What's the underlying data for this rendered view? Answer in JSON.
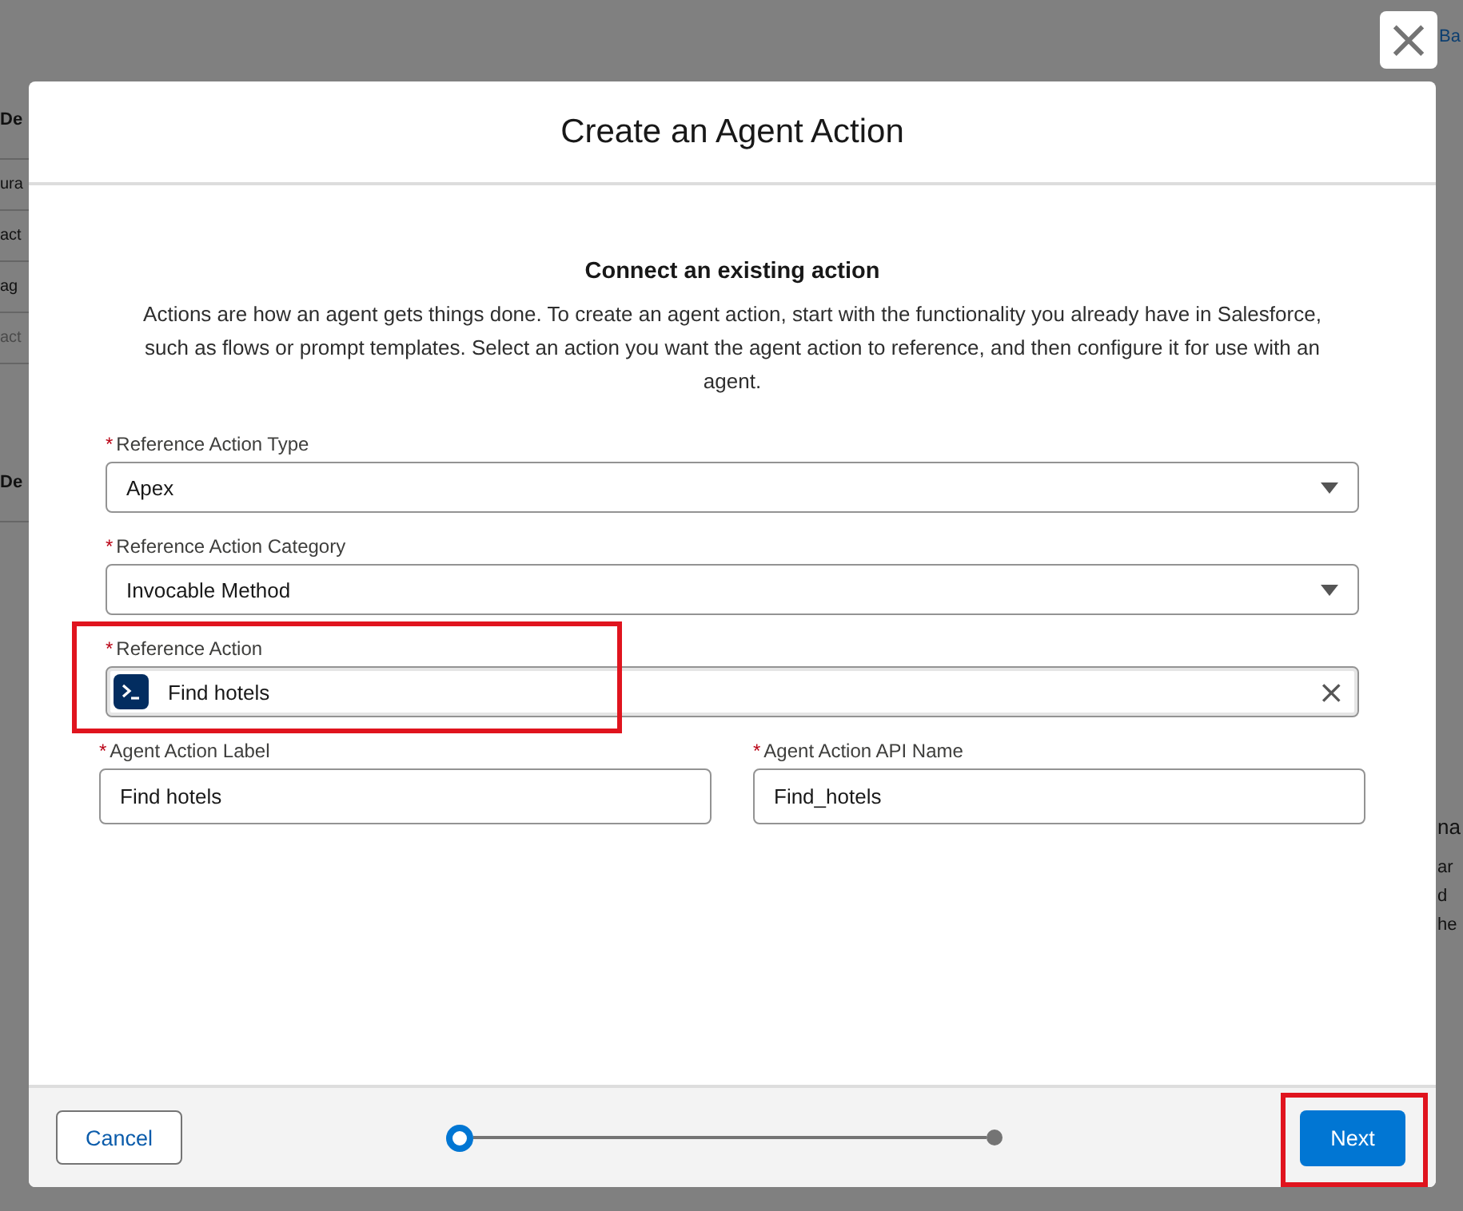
{
  "background": {
    "left_fragments": [
      {
        "text": "De",
        "kind": "heading"
      },
      {
        "text": "ura",
        "kind": "text"
      },
      {
        "text": "act",
        "kind": "text"
      },
      {
        "text": "ag",
        "kind": "text"
      },
      {
        "text": "act",
        "kind": "muted"
      },
      {
        "text": "De",
        "kind": "heading"
      }
    ],
    "top_link": "Ba",
    "right_fragments": [
      {
        "text": "na",
        "kind": "heading"
      },
      {
        "text": "ar",
        "kind": "text"
      },
      {
        "text": "d",
        "kind": "text"
      },
      {
        "text": "he",
        "kind": "text"
      }
    ]
  },
  "close_button": "×",
  "modal": {
    "title": "Create an Agent Action",
    "heading": "Connect an existing action",
    "description": "Actions are how an agent gets things done. To create an agent action, start with the functionality you already have in Salesforce, such as flows or prompt templates. Select an action you want the agent action to reference, and then configure it for use with an agent.",
    "fields": [
      {
        "kind": "select",
        "label": "Reference Action Type",
        "required_mark": "*",
        "value": "Apex",
        "highlighted": false
      },
      {
        "kind": "select",
        "label": "Reference Action Category",
        "required_mark": "*",
        "value": "Invocable Method",
        "highlighted": false
      },
      {
        "kind": "lookup",
        "label": "Reference Action",
        "required_mark": "*",
        "value": "Find hotels",
        "clear": "×",
        "highlighted": true
      }
    ],
    "pair_fields": [
      {
        "label": "Agent Action Label",
        "required_mark": "*",
        "value": "Find hotels"
      },
      {
        "label": "Agent Action API Name",
        "required_mark": "*",
        "value": "Find_hotels"
      }
    ]
  },
  "footer": {
    "cancel": "Cancel",
    "steps": [
      {
        "selected": true
      },
      {
        "selected": false
      }
    ],
    "next": {
      "label": "Next",
      "highlighted": true
    }
  }
}
